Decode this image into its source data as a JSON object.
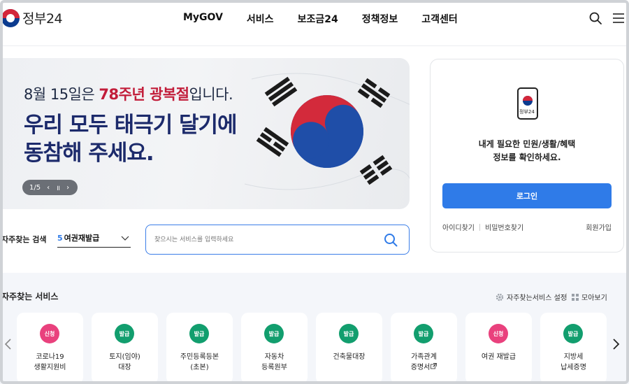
{
  "header": {
    "logo_text": "정부24",
    "nav": [
      "MyGOV",
      "서비스",
      "보조금24",
      "정책정보",
      "고객센터"
    ],
    "icons": [
      "search-icon",
      "hamburger-menu-icon"
    ]
  },
  "banner": {
    "line1_prefix": "8월 15일은 ",
    "line1_highlight": "78주년 광복절",
    "line1_suffix": "입니다.",
    "line2": "우리 모두 태극기 달기에",
    "line3": "동참해 주세요.",
    "slide_counter": "1/5",
    "pause_glyph": "॥",
    "prev_glyph": "‹",
    "next_glyph": "›",
    "colors": {
      "highlight": "#c21d3a",
      "headline": "#1c2a6b"
    }
  },
  "login": {
    "phone_label": "정부24",
    "message_line1": "내게 필요한 민원/생활/혜택",
    "message_line2": "정보를 확인하세요.",
    "button": "로그인",
    "find_id": "아이디찾기",
    "find_pw": "비밀번호찾기",
    "signup": "회원가입",
    "accent": "#2f7be8"
  },
  "search": {
    "fav_label": "자주찾는 검색",
    "selected_rank": "5",
    "selected_text": "여권재발급",
    "placeholder": "찾으시는 서비스를 입력하세요"
  },
  "services": {
    "title": "자주찾는 서비스",
    "settings_label": "자주찾는서비스 설정",
    "view_all_label": "모아보기",
    "cards": [
      {
        "badge": "신청",
        "badge_color": "pink",
        "line1": "코로나19",
        "line2": "생활지원비"
      },
      {
        "badge": "발급",
        "badge_color": "green",
        "line1": "토지(임야)",
        "line2": "대장"
      },
      {
        "badge": "발급",
        "badge_color": "green",
        "line1": "주민등록등본",
        "line2": "(초본)"
      },
      {
        "badge": "발급",
        "badge_color": "green",
        "line1": "자동차",
        "line2": "등록원부"
      },
      {
        "badge": "발급",
        "badge_color": "green",
        "line1": "건축물대장",
        "line2": ""
      },
      {
        "badge": "발급",
        "badge_color": "green",
        "line1": "가족관계",
        "line2": "증명서"
      },
      {
        "badge": "신청",
        "badge_color": "pink",
        "line1": "여권 재발급",
        "line2": ""
      },
      {
        "badge": "발급",
        "badge_color": "green",
        "line1": "지방세",
        "line2": "납세증명"
      }
    ]
  }
}
